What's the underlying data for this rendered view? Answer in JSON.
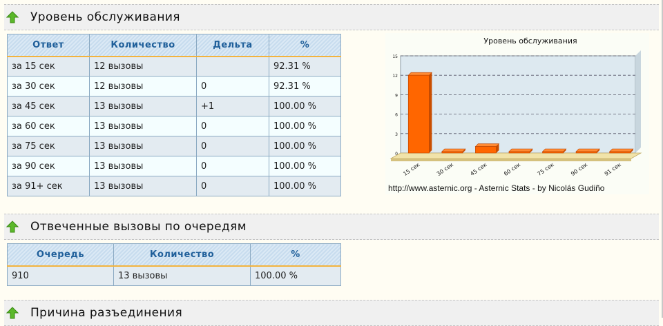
{
  "sections": [
    {
      "title": "Уровень обслуживания"
    },
    {
      "title": "Отвеченные вызовы по очередям"
    },
    {
      "title": "Причина разъединения"
    }
  ],
  "service_table": {
    "headers": [
      "Ответ",
      "Количество",
      "Дельта",
      "%"
    ],
    "rows": [
      [
        "за 15 сек",
        "12 вызовы",
        "",
        "92.31 %"
      ],
      [
        "за 30 сек",
        "12 вызовы",
        "0",
        "92.31 %"
      ],
      [
        "за 45 сек",
        "13 вызовы",
        "+1",
        "100.00 %"
      ],
      [
        "за 60 сек",
        "13 вызовы",
        "0",
        "100.00 %"
      ],
      [
        "за 75 сек",
        "13 вызовы",
        "0",
        "100.00 %"
      ],
      [
        "за 90 сек",
        "13 вызовы",
        "0",
        "100.00 %"
      ],
      [
        "за 91+ сек",
        "13 вызовы",
        "0",
        "100.00 %"
      ]
    ]
  },
  "queue_table": {
    "headers": [
      "Очередь",
      "Количество",
      "%"
    ],
    "rows": [
      [
        "910",
        "13 вызовы",
        "100.00 %"
      ]
    ]
  },
  "chart_credit": "http://www.asternic.org - Asternic Stats - by Nicolás Gudiño",
  "icons": {
    "section_arrow": "green-up-arrow-icon"
  },
  "colors": {
    "bar": "#ff6600",
    "header_text": "#1f5f9a",
    "header_underline": "#f3b33d"
  },
  "chart_data": {
    "type": "bar",
    "title": "Уровень обслуживания",
    "categories": [
      "15 сек",
      "30 сек",
      "45 сек",
      "60 сек",
      "75 сек",
      "90 сек",
      "91 сек"
    ],
    "values": [
      12,
      0,
      1,
      0,
      0,
      0,
      0
    ],
    "yticks": [
      "0",
      "3",
      "6",
      "9",
      "12",
      "15"
    ],
    "ylim": [
      0,
      15
    ],
    "grid": true,
    "style": "3d"
  }
}
